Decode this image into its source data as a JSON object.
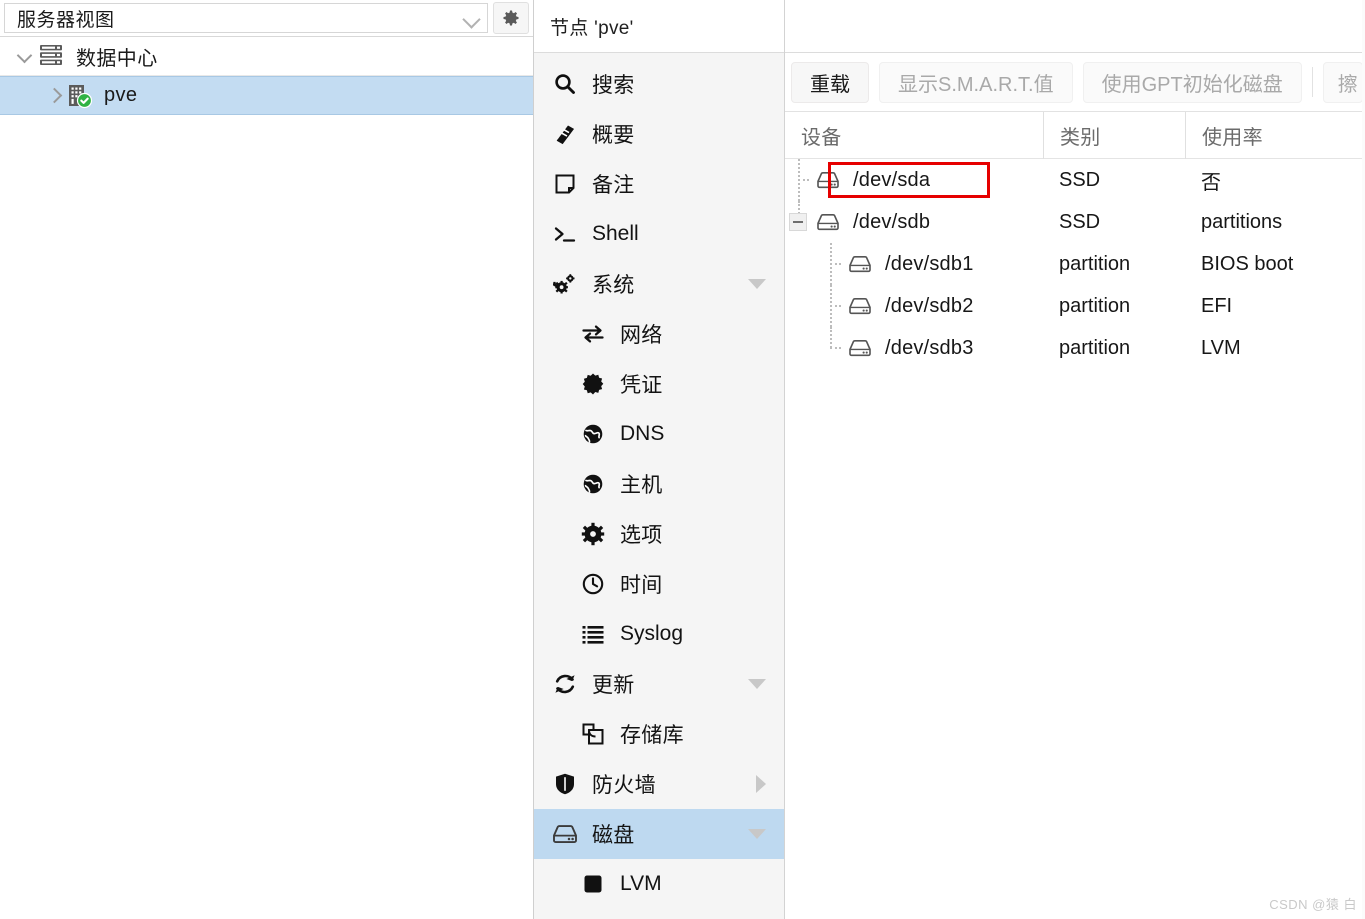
{
  "tree_panel": {
    "view_selector": {
      "label": "服务器视图",
      "icon": "chevron-down-icon"
    },
    "settings_button_icon": "gear-icon",
    "nodes": [
      {
        "label": "数据中心",
        "icon": "datacenter-icon",
        "arrow": "down",
        "selected": false,
        "level": 0
      },
      {
        "label": "pve",
        "icon": "node-online-icon",
        "arrow": "right",
        "selected": true,
        "level": 1
      }
    ]
  },
  "node_panel": {
    "title": "节点 'pve'",
    "menu": [
      {
        "label": "搜索",
        "icon": "search-icon",
        "level": 0,
        "caret": "",
        "active": false
      },
      {
        "label": "概要",
        "icon": "book-icon",
        "level": 0,
        "caret": "",
        "active": false
      },
      {
        "label": "备注",
        "icon": "note-icon",
        "level": 0,
        "caret": "",
        "active": false
      },
      {
        "label": "Shell",
        "icon": "terminal-icon",
        "level": 0,
        "caret": "",
        "active": false
      },
      {
        "label": "系统",
        "icon": "gears-icon",
        "level": 0,
        "caret": "down",
        "active": false
      },
      {
        "label": "网络",
        "icon": "network-icon",
        "level": 1,
        "caret": "",
        "active": false
      },
      {
        "label": "凭证",
        "icon": "certificate-icon",
        "level": 1,
        "caret": "",
        "active": false
      },
      {
        "label": "DNS",
        "icon": "globe-icon",
        "level": 1,
        "caret": "",
        "active": false
      },
      {
        "label": "主机",
        "icon": "globe-icon",
        "level": 1,
        "caret": "",
        "active": false
      },
      {
        "label": "选项",
        "icon": "gear-icon",
        "level": 1,
        "caret": "",
        "active": false
      },
      {
        "label": "时间",
        "icon": "clock-icon",
        "level": 1,
        "caret": "",
        "active": false
      },
      {
        "label": "Syslog",
        "icon": "list-icon",
        "level": 1,
        "caret": "",
        "active": false
      },
      {
        "label": "更新",
        "icon": "refresh-icon",
        "level": 0,
        "caret": "down",
        "active": false
      },
      {
        "label": "存储库",
        "icon": "repository-icon",
        "level": 1,
        "caret": "",
        "active": false
      },
      {
        "label": "防火墙",
        "icon": "shield-icon",
        "level": 0,
        "caret": "right",
        "active": false
      },
      {
        "label": "磁盘",
        "icon": "disk-icon",
        "level": 0,
        "caret": "down",
        "active": true
      },
      {
        "label": "LVM",
        "icon": "square-icon",
        "level": 1,
        "caret": "",
        "active": false
      }
    ]
  },
  "content": {
    "toolbar": {
      "buttons": [
        {
          "label": "重载",
          "disabled": false
        },
        {
          "label": "显示S.M.A.R.T.值",
          "disabled": true
        },
        {
          "label": "使用GPT初始化磁盘",
          "disabled": true
        }
      ],
      "clipped_button": {
        "label": "擦",
        "disabled": true
      }
    },
    "grid": {
      "columns": [
        "设备",
        "类别",
        "使用率"
      ],
      "rows": [
        {
          "device": "/dev/sda",
          "type": "SSD",
          "usage": "否",
          "level": 0,
          "highlighted": true,
          "expander": "none"
        },
        {
          "device": "/dev/sdb",
          "type": "SSD",
          "usage": "partitions",
          "level": 0,
          "highlighted": false,
          "expander": "collapse"
        },
        {
          "device": "/dev/sdb1",
          "type": "partition",
          "usage": "BIOS boot",
          "level": 1,
          "highlighted": false,
          "expander": "none"
        },
        {
          "device": "/dev/sdb2",
          "type": "partition",
          "usage": "EFI",
          "level": 1,
          "highlighted": false,
          "expander": "none"
        },
        {
          "device": "/dev/sdb3",
          "type": "partition",
          "usage": "LVM",
          "level": 1,
          "highlighted": false,
          "expander": "none"
        }
      ]
    },
    "watermark": "CSDN @猿 白"
  },
  "colors": {
    "selection_blue": "#c3dcf2",
    "menu_active_blue": "#bed9f0",
    "highlight_red": "#e60000",
    "node_status_green": "#2fb344"
  }
}
